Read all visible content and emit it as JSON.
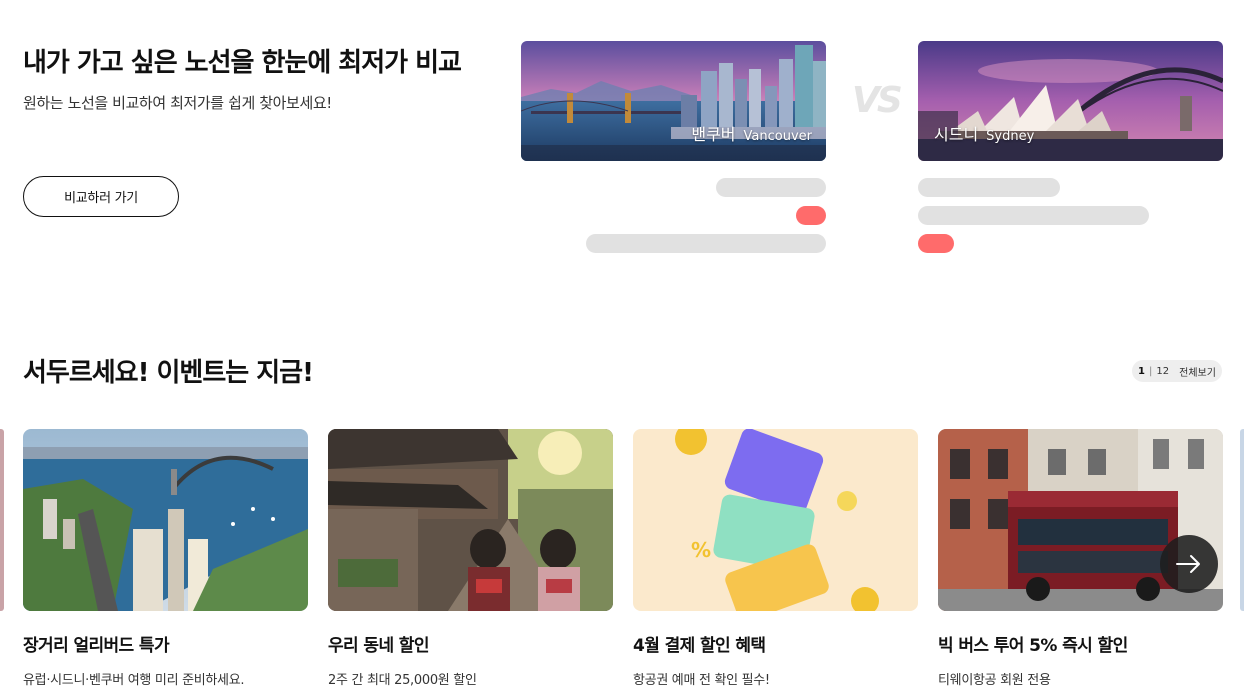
{
  "compare": {
    "title": "내가 가고 싶은 노선을 한눈에 최저가 비교",
    "subtitle": "원하는 노선을 비교하여 최저가를 쉽게 찾아보세요!",
    "button_label": "비교하러 가기",
    "vs_label": "VS",
    "left_city": {
      "name_ko": "밴쿠버",
      "name_en": "Vancouver"
    },
    "right_city": {
      "name_ko": "시드니",
      "name_en": "Sydney"
    },
    "skeleton_color": "#e1e1e1",
    "price_badge_color": "#ff6b6b"
  },
  "events": {
    "title": "서두르세요! 이벤트는 지금!",
    "pager": {
      "current": "1",
      "total": "12",
      "view_all": "전체보기"
    },
    "cards": [
      {
        "name": "장거리 얼리버드 특가",
        "desc": "유럽·시드니·벤쿠버 여행 미리 준비하세요.",
        "image": "sydney-harbour-aerial"
      },
      {
        "name": "우리 동네 할인",
        "desc": "2주 간 최대 25,000원 할인",
        "image": "kyoto-street-kimono"
      },
      {
        "name": "4월 결제 할인 혜택",
        "desc": "항공권 예매 전 확인 필수!",
        "image": "credit-cards-coins"
      },
      {
        "name": "빅 버스 투어 5% 즉시 할인",
        "desc": "티웨이항공 회원 전용",
        "image": "double-decker-bus"
      }
    ],
    "next_icon": "arrow-right-icon"
  }
}
